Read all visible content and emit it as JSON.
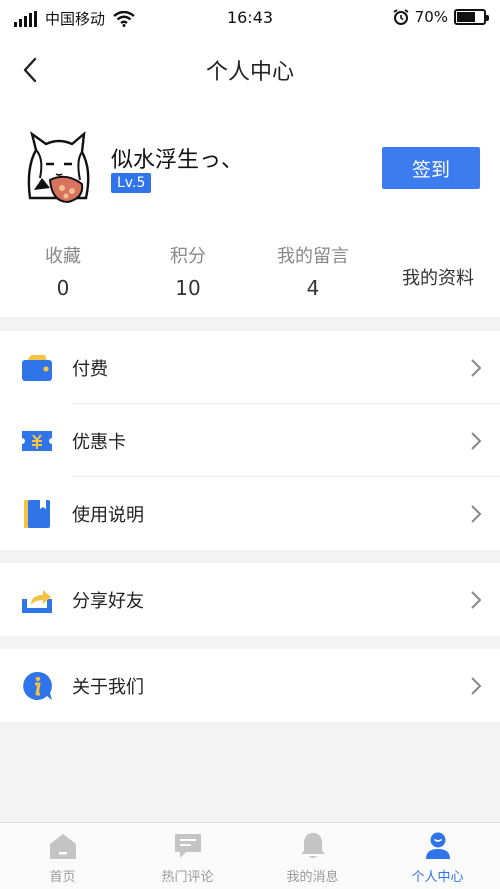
{
  "status_bar": {
    "carrier": "中国移动",
    "time": "16:43",
    "battery": "70%",
    "battery_level": 0.7
  },
  "nav": {
    "title": "个人中心",
    "back_icon": "chevron-left-icon"
  },
  "profile": {
    "username": "似水浮生っ、",
    "level": "Lv.5",
    "checkin_label": "签到",
    "stats": [
      {
        "label": "收藏",
        "value": "0"
      },
      {
        "label": "积分",
        "value": "10"
      },
      {
        "label": "我的留言",
        "value": "4"
      }
    ],
    "my_info_label": "我的资料"
  },
  "menu_groups": [
    [
      {
        "label": "付费",
        "icon": "wallet-icon"
      },
      {
        "label": "优惠卡",
        "icon": "coupon-icon"
      },
      {
        "label": "使用说明",
        "icon": "book-icon"
      }
    ],
    [
      {
        "label": "分享好友",
        "icon": "share-icon"
      }
    ],
    [
      {
        "label": "关于我们",
        "icon": "info-icon"
      }
    ]
  ],
  "tab_bar": [
    {
      "label": "首页",
      "icon": "home-icon",
      "active": false
    },
    {
      "label": "热门评论",
      "icon": "comment-icon",
      "active": false
    },
    {
      "label": "我的消息",
      "icon": "bell-icon",
      "active": false
    },
    {
      "label": "个人中心",
      "icon": "user-icon",
      "active": true
    }
  ],
  "colors": {
    "accent": "#2f74e8",
    "button": "#3d7cee",
    "icon_yellow": "#f5c343",
    "tab_inactive": "#c4c4c4"
  }
}
